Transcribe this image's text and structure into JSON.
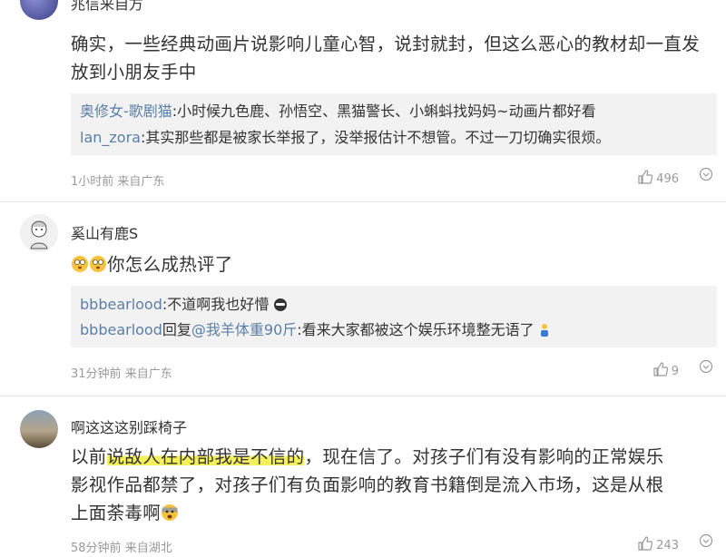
{
  "comments": [
    {
      "username": "兆信来自方",
      "text": "确实，一些经典动画片说影响儿童心智，说封就封，但这么恶心的教材却一直发放到小朋友手中",
      "replies": [
        {
          "name": "奥修女-歌剧猫",
          "text": ":小时候九色鹿、孙悟空、黑猫警长、小蝌蚪找妈妈~动画片都好看"
        },
        {
          "name": "lan_zora",
          "text": ":其实那些都是被家长举报了，没举报估计不想管。不过一刀切确实很烦。"
        }
      ],
      "time": "1小时前",
      "location": "来自广东",
      "likes": "496"
    },
    {
      "username": "奚山有鹿S",
      "text": "你怎么成热评了",
      "replies": [
        {
          "name": "bbbearlood",
          "text": ":不道啊我也好懵"
        },
        {
          "name": "bbbearlood",
          "mid": "回复",
          "mention": "@我羊体重90斤",
          "text": ":看来大家都被这个娱乐环境整无语了"
        }
      ],
      "time": "31分钟前",
      "location": "来自广东",
      "likes": "9"
    },
    {
      "username": "啊这这这别踩椅子",
      "text_before": "以前",
      "text_highlight": "说敌人在内部我是不信的",
      "text_line1_after": "，现在信了。对孩子们有没有影响的正常娱乐",
      "text_line2": "影视作品都禁了，对孩子们有负面影响的教育书籍倒是流入市场，这是从根",
      "text_line3": "上面荼毒啊",
      "time": "58分钟前",
      "location": "来自湖北",
      "likes": "243"
    }
  ],
  "icons": {
    "like": "thumbs-up-icon",
    "more": "more-options-icon"
  }
}
